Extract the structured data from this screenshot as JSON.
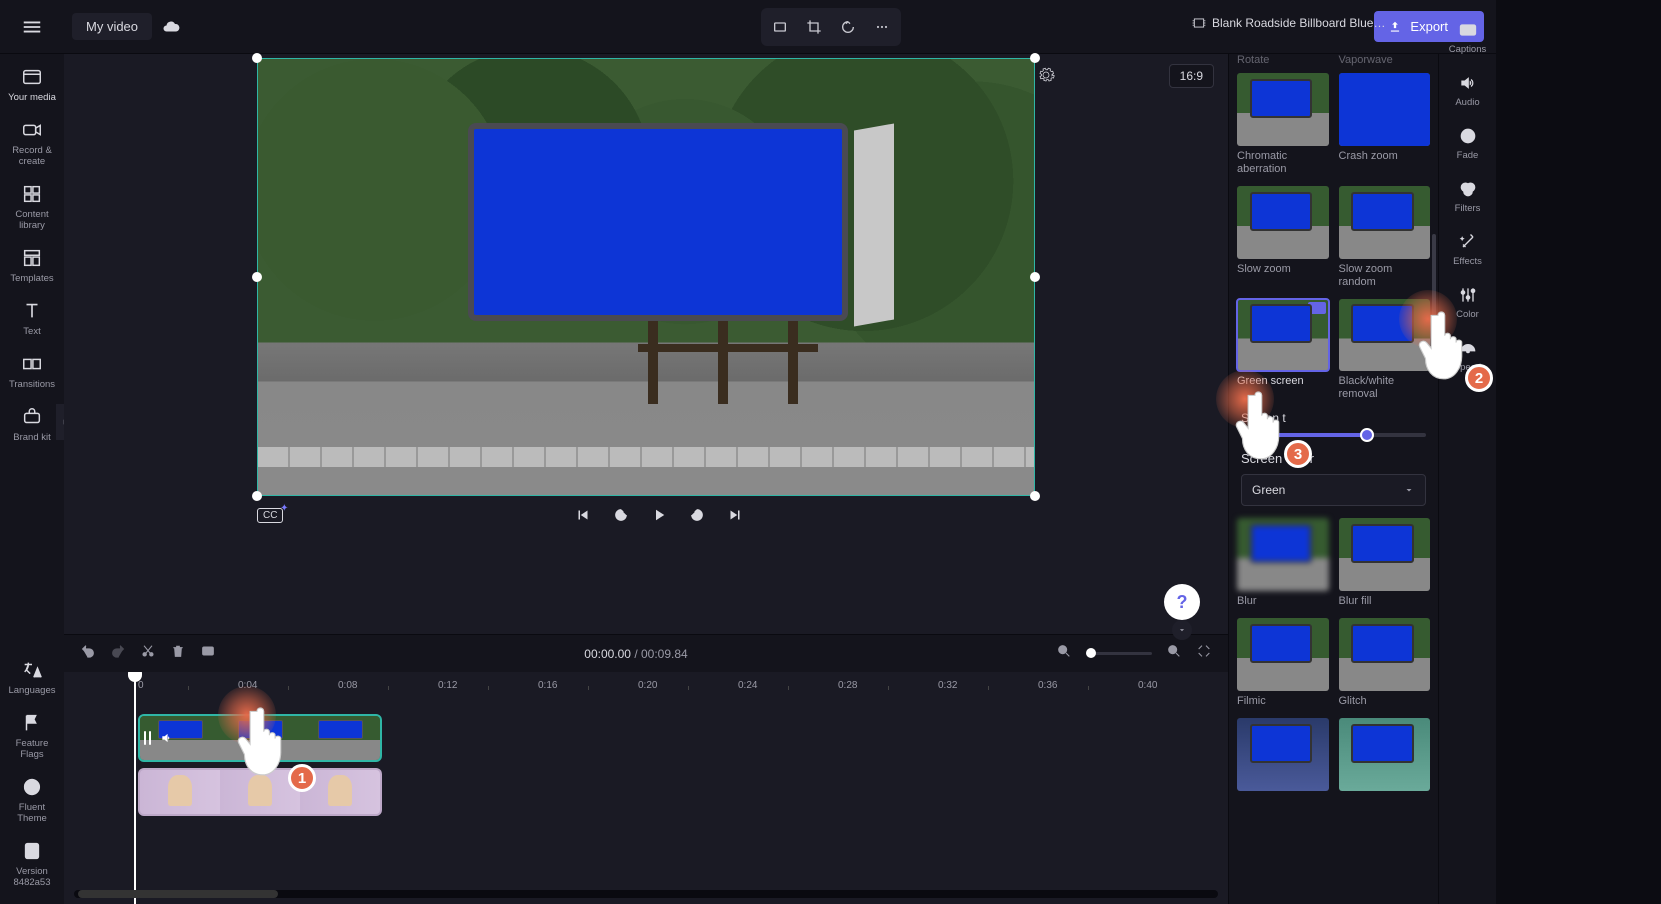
{
  "topbar": {
    "project_name": "My video",
    "export_label": "Export"
  },
  "aspect_ratio": "16:9",
  "leftrail": {
    "items": [
      {
        "name": "your-media",
        "label": "Your media"
      },
      {
        "name": "record-create",
        "label": "Record & create"
      },
      {
        "name": "content-library",
        "label": "Content library"
      },
      {
        "name": "templates",
        "label": "Templates"
      },
      {
        "name": "text",
        "label": "Text"
      },
      {
        "name": "transitions",
        "label": "Transitions"
      },
      {
        "name": "brand-kit",
        "label": "Brand kit"
      }
    ],
    "bottom": [
      {
        "name": "languages",
        "label": "Languages"
      },
      {
        "name": "feature-flags",
        "label": "Feature Flags"
      },
      {
        "name": "fluent-theme",
        "label": "Fluent Theme"
      },
      {
        "name": "version",
        "label": "Version 8482a53"
      }
    ]
  },
  "playback": {
    "current": "00:00.00",
    "total": "00:09.84"
  },
  "timeline": {
    "ticks": [
      "0",
      "0:04",
      "0:08",
      "0:12",
      "0:16",
      "0:20",
      "0:24",
      "0:28",
      "0:32",
      "0:36",
      "0:40"
    ]
  },
  "clip_title": "Blank Roadside Billboard Blue S...",
  "effects": {
    "row_partial": [
      "Rotate",
      "Vaporwave"
    ],
    "rows": [
      [
        "Chromatic aberration",
        "Crash zoom"
      ],
      [
        "Slow zoom",
        "Slow zoom random"
      ],
      [
        "Green screen",
        "Black/white removal"
      ]
    ],
    "threshold_label": "Screen t",
    "screen_color_label": "Screen color",
    "screen_color_value": "Green",
    "rows2": [
      [
        "Blur",
        "Blur fill"
      ],
      [
        "Filmic",
        "Glitch"
      ]
    ]
  },
  "rightrail": {
    "items": [
      {
        "name": "captions",
        "label": "Captions"
      },
      {
        "name": "audio",
        "label": "Audio"
      },
      {
        "name": "fade",
        "label": "Fade"
      },
      {
        "name": "filters",
        "label": "Filters"
      },
      {
        "name": "effects",
        "label": "Effects"
      },
      {
        "name": "adjust",
        "label": "Color"
      },
      {
        "name": "speed",
        "label": "Speed"
      }
    ]
  },
  "pointers": {
    "p1": "1",
    "p2": "2",
    "p3": "3"
  },
  "help": "?"
}
